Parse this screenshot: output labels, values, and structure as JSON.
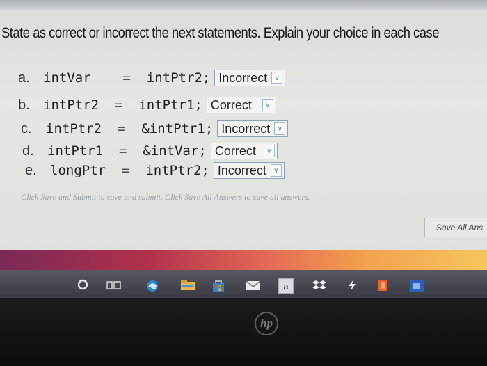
{
  "question": {
    "title": "State as correct or incorrect the next statements. Explain your choice in each case"
  },
  "statements": [
    {
      "letter": "a.",
      "lhs": "intVar",
      "rhs": "intPtr2;",
      "answer": "Incorrect"
    },
    {
      "letter": "b.",
      "lhs": "intPtr2",
      "rhs": "intPtr1;",
      "answer": "Correct"
    },
    {
      "letter": "c.",
      "lhs": "intPtr2",
      "rhs": "&intPtr1;",
      "answer": "Incorrect"
    },
    {
      "letter": "d.",
      "lhs": "intPtr1",
      "rhs": "&intVar;",
      "answer": "Correct"
    },
    {
      "letter": "e.",
      "lhs": "longPtr",
      "rhs": "intPtr2;",
      "answer": "Incorrect"
    }
  ],
  "equals_sign": "=",
  "instructions": "Click Save and Submit to save and submit. Click Save All Answers to save all answers.",
  "save_all_button": "Save All Ans",
  "taskbar": {
    "icons": [
      "cortana-icon",
      "task-view-icon",
      "edge-icon",
      "file-explorer-icon",
      "store-icon",
      "mail-icon",
      "amazon-icon",
      "dropbox-icon",
      "bolt-app-icon",
      "office-icon",
      "word-icon"
    ],
    "amazon_label": "a"
  },
  "laptop": {
    "brand_logo": "hp"
  }
}
